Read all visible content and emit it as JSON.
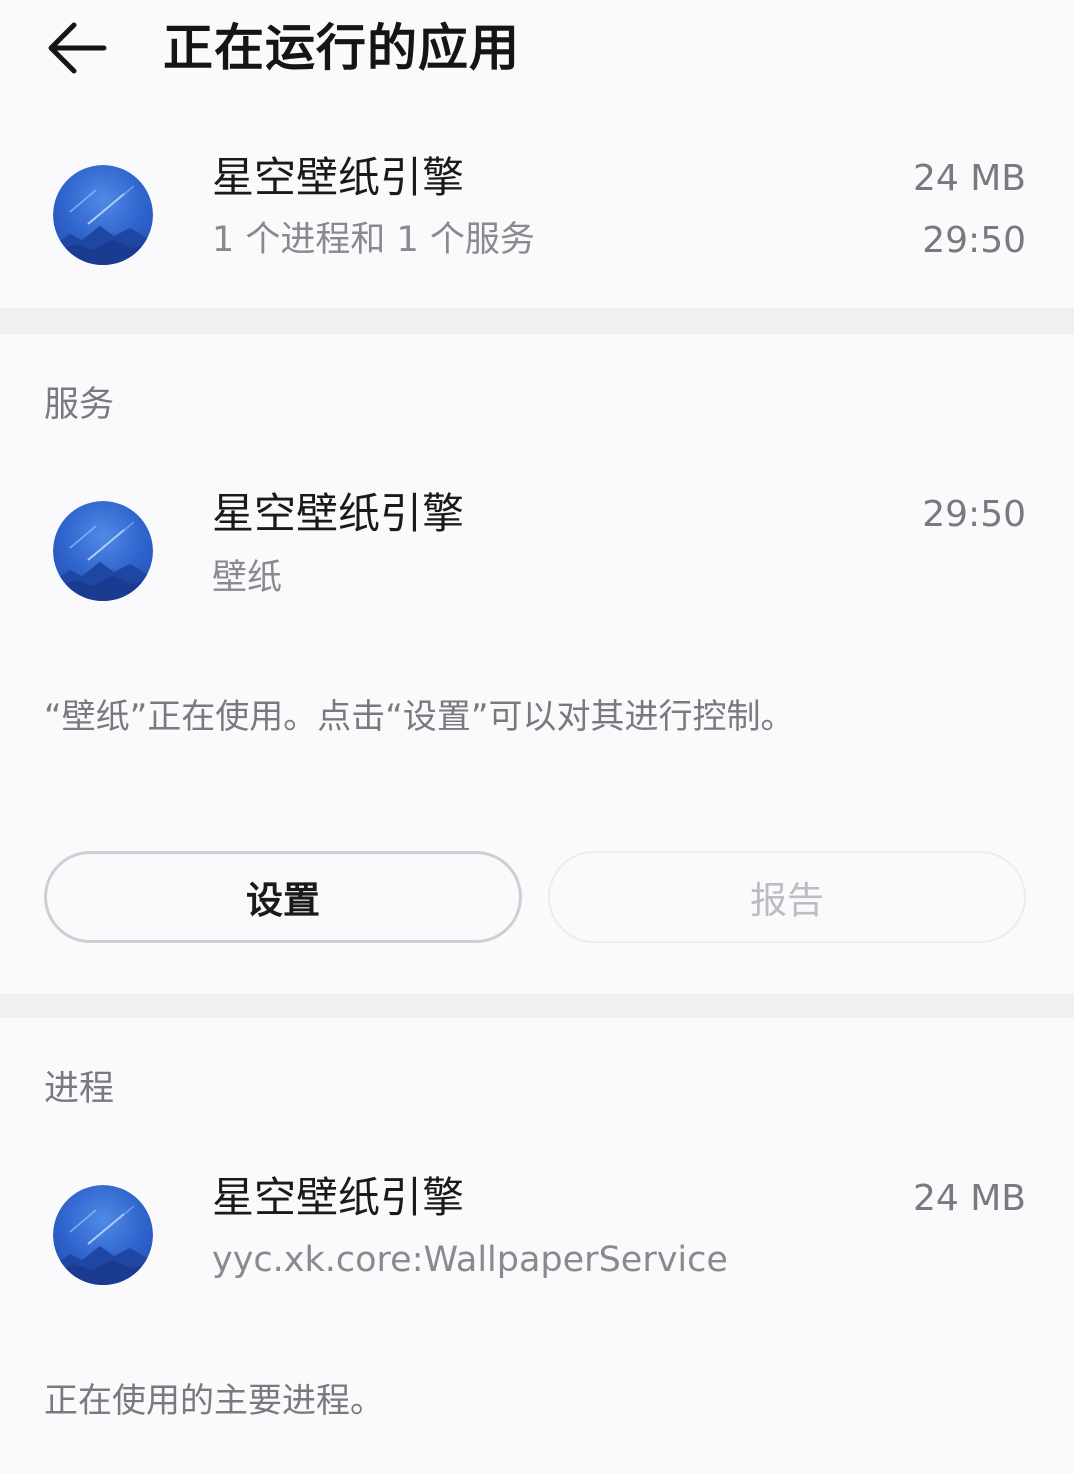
{
  "header": {
    "title": "正在运行的应用",
    "back_icon": "arrow-left-icon"
  },
  "app_summary": {
    "icon": "starry-sky-app-icon",
    "name": "星空壁纸引擎",
    "detail": "1 个进程和 1 个服务",
    "memory": "24 MB",
    "time": "29:50"
  },
  "services": {
    "section_title": "服务",
    "item": {
      "icon": "starry-sky-app-icon",
      "name": "星空壁纸引擎",
      "subtitle": "壁纸",
      "time": "29:50"
    },
    "description": "“壁纸”正在使用。点击“设置”可以对其进行控制。",
    "buttons": {
      "settings_label": "设置",
      "report_label": "报告"
    }
  },
  "processes": {
    "section_title": "进程",
    "item": {
      "icon": "starry-sky-app-icon",
      "name": "星空壁纸引擎",
      "subtitle": "yyc.xk.core:WallpaperService",
      "memory": "24 MB"
    },
    "description": "正在使用的主要进程。"
  },
  "colors": {
    "background": "#fafafc",
    "divider": "#f0f0f2",
    "icon_blue": "#2f63cc"
  }
}
